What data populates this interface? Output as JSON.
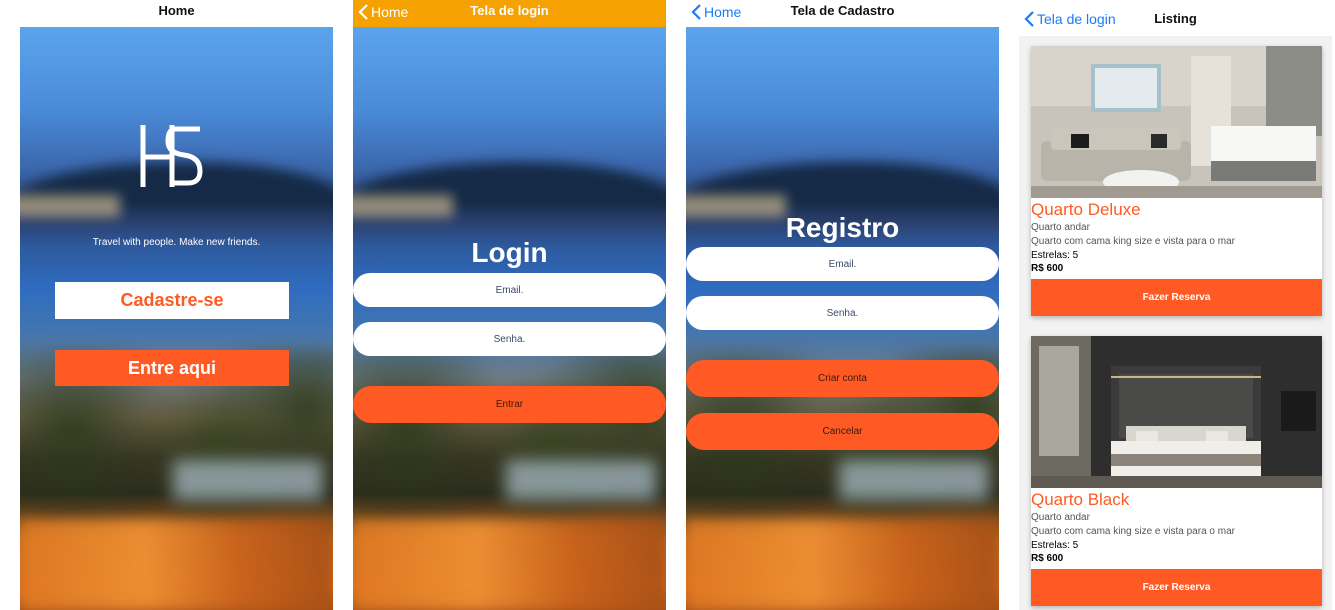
{
  "home": {
    "nav_title": "Home",
    "logo_text": "HS",
    "tagline": "Travel with people. Make new friends.",
    "signup_button": "Cadastre-se",
    "enter_button": "Entre aqui"
  },
  "login": {
    "nav_back": "Home",
    "nav_title": "Tela de login",
    "title": "Login",
    "email_placeholder": "Email.",
    "password_placeholder": "Senha.",
    "submit_button": "Entrar"
  },
  "register": {
    "nav_back": "Home",
    "nav_title": "Tela de Cadastro",
    "title": "Registro",
    "email_placeholder": "Email.",
    "password_placeholder": "Senha.",
    "create_button": "Criar conta",
    "cancel_button": "Cancelar"
  },
  "listing": {
    "nav_back": "Tela de login",
    "nav_title": "Listing",
    "rooms": [
      {
        "title": "Quarto Deluxe",
        "floor": "Quarto andar",
        "description": "Quarto com cama king size e vista para o mar",
        "stars": "Estrelas: 5",
        "price": "R$ 600",
        "button": "Fazer Reserva"
      },
      {
        "title": "Quarto Black",
        "floor": "Quarto andar",
        "description": "Quarto com cama king size e vista para o mar",
        "stars": "Estrelas: 5",
        "price": "R$ 600",
        "button": "Fazer Reserva"
      }
    ]
  },
  "colors": {
    "accent": "#ff5a24",
    "ios_blue": "#1a7cf5",
    "login_nav": "#f5a200"
  },
  "icons": {
    "back": "chevron-left-icon"
  }
}
